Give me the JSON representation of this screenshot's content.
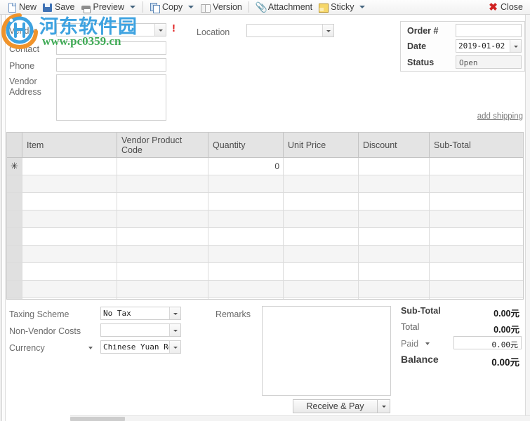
{
  "toolbar": {
    "items": [
      {
        "label": "New",
        "icon": "new-document-icon",
        "dropdown": false
      },
      {
        "label": "Save",
        "icon": "save-disk-icon",
        "dropdown": false
      },
      {
        "label": "Preview",
        "icon": "printer-icon",
        "dropdown": true
      },
      {
        "label": "Copy",
        "icon": "copy-pages-icon",
        "dropdown": true
      },
      {
        "label": "Version",
        "icon": "book-icon",
        "dropdown": false
      },
      {
        "label": "Attachment",
        "icon": "paperclip-icon",
        "dropdown": false
      },
      {
        "label": "Sticky",
        "icon": "sticky-note-icon",
        "dropdown": true
      }
    ],
    "close_label": "Close",
    "close_icon": "red-x-icon"
  },
  "header": {
    "vendor_label": "Vendor",
    "vendor_value": "",
    "vendor_required_marker": "!",
    "contact_label": "Contact",
    "contact_value": "",
    "phone_label": "Phone",
    "phone_value": "",
    "vendor_address_label_line1": "Vendor",
    "vendor_address_label_line2": "Address",
    "vendor_address_value": "",
    "location_label": "Location",
    "location_value": ""
  },
  "order_box": {
    "order_no_label": "Order #",
    "order_no_value": "",
    "date_label": "Date",
    "date_value": "2019-01-02",
    "status_label": "Status",
    "status_value": "Open"
  },
  "add_shipping_link": "add shipping",
  "grid": {
    "columns": [
      "",
      "Item",
      "Vendor Product Code",
      "Quantity",
      "Unit Price",
      "Discount",
      "Sub-Total"
    ],
    "new_row_marker": "✳",
    "rows": [
      {
        "marker": "✳",
        "item": "",
        "vendor_product_code": "",
        "quantity": "0",
        "unit_price": "",
        "discount": "",
        "sub_total": ""
      },
      {
        "marker": "",
        "item": "",
        "vendor_product_code": "",
        "quantity": "",
        "unit_price": "",
        "discount": "",
        "sub_total": ""
      },
      {
        "marker": "",
        "item": "",
        "vendor_product_code": "",
        "quantity": "",
        "unit_price": "",
        "discount": "",
        "sub_total": ""
      },
      {
        "marker": "",
        "item": "",
        "vendor_product_code": "",
        "quantity": "",
        "unit_price": "",
        "discount": "",
        "sub_total": ""
      },
      {
        "marker": "",
        "item": "",
        "vendor_product_code": "",
        "quantity": "",
        "unit_price": "",
        "discount": "",
        "sub_total": ""
      },
      {
        "marker": "",
        "item": "",
        "vendor_product_code": "",
        "quantity": "",
        "unit_price": "",
        "discount": "",
        "sub_total": ""
      },
      {
        "marker": "",
        "item": "",
        "vendor_product_code": "",
        "quantity": "",
        "unit_price": "",
        "discount": "",
        "sub_total": ""
      },
      {
        "marker": "",
        "item": "",
        "vendor_product_code": "",
        "quantity": "",
        "unit_price": "",
        "discount": "",
        "sub_total": ""
      },
      {
        "marker": "",
        "item": "",
        "vendor_product_code": "",
        "quantity": "",
        "unit_price": "",
        "discount": "",
        "sub_total": ""
      }
    ]
  },
  "footer": {
    "taxing_scheme_label": "Taxing Scheme",
    "taxing_scheme_value": "No Tax",
    "non_vendor_costs_label": "Non-Vendor Costs",
    "non_vendor_costs_value": "",
    "currency_label": "Currency",
    "currency_value": "Chinese Yuan Ren",
    "remarks_label": "Remarks",
    "remarks_value": "",
    "receive_pay_label": "Receive & Pay"
  },
  "totals": {
    "sub_total_label": "Sub-Total",
    "sub_total_value": "0.00元",
    "total_label": "Total",
    "total_value": "0.00元",
    "paid_label": "Paid",
    "paid_value": "0.00元",
    "balance_label": "Balance",
    "balance_value": "0.00元"
  },
  "watermark": {
    "chinese_text": "河东软件园",
    "url_text": "www.pc0359.cn",
    "chinese_color": "#3da2e0",
    "url_color": "#3faa55",
    "logo_blue": "#3da2e0",
    "logo_orange": "#f0932b"
  }
}
